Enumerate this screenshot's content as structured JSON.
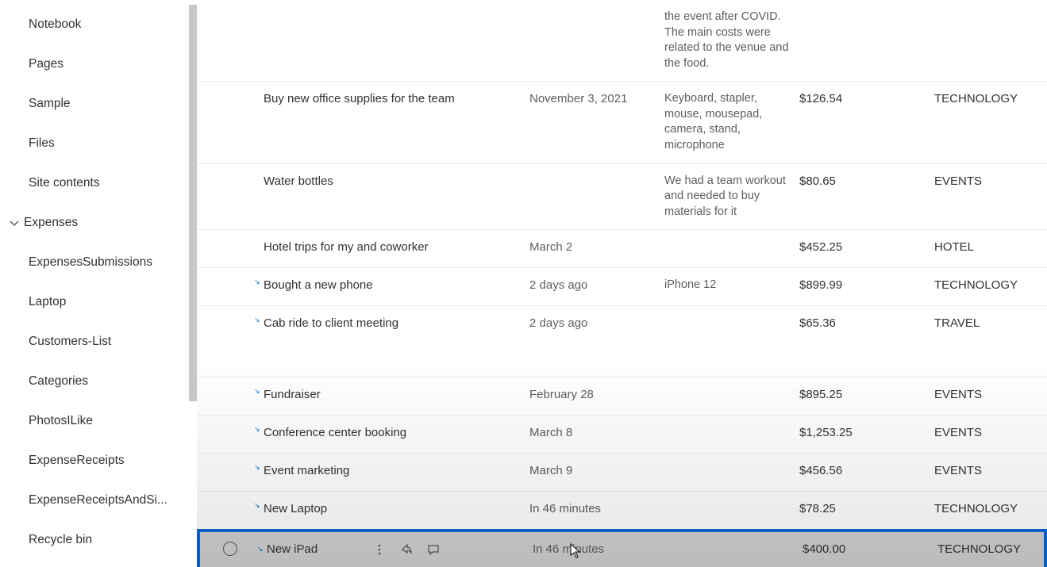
{
  "sidebar": {
    "items": [
      {
        "label": "Notebook"
      },
      {
        "label": "Pages"
      },
      {
        "label": "Sample"
      },
      {
        "label": "Files"
      },
      {
        "label": "Site contents"
      }
    ],
    "section_label": "Expenses",
    "expenses_items": [
      {
        "label": "ExpensesSubmissions"
      },
      {
        "label": "Laptop"
      },
      {
        "label": "Customers-List"
      },
      {
        "label": "Categories"
      },
      {
        "label": "PhotosILike"
      },
      {
        "label": "ExpenseReceipts"
      },
      {
        "label": "ExpenseReceiptsAndSi..."
      },
      {
        "label": "Recycle bin"
      }
    ]
  },
  "rows": [
    {
      "title": "",
      "date": "",
      "desc": "the event after COVID. The main costs were related to the venue and the food.",
      "amount": "",
      "category": "",
      "linked": false
    },
    {
      "title": "Buy new office supplies for the team",
      "date": "November 3, 2021",
      "desc": "Keyboard, stapler, mouse, mousepad, camera, stand, microphone",
      "amount": "$126.54",
      "category": "TECHNOLOGY",
      "linked": false
    },
    {
      "title": "Water bottles",
      "date": "",
      "desc": "We had a team workout and needed to buy materials for it",
      "amount": "$80.65",
      "category": "EVENTS",
      "linked": false
    },
    {
      "title": "Hotel trips for my and coworker",
      "date": "March 2",
      "desc": "",
      "amount": "$452.25",
      "category": "HOTEL",
      "linked": false
    },
    {
      "title": "Bought a new phone",
      "date": "2 days ago",
      "desc": "iPhone 12",
      "amount": "$899.99",
      "category": "TECHNOLOGY",
      "linked": true
    },
    {
      "title": "Cab ride to client meeting",
      "date": "2 days ago",
      "desc": "",
      "amount": "$65.36",
      "category": "TRAVEL",
      "linked": true
    },
    {
      "title": "Fundraiser",
      "date": "February 28",
      "desc": "",
      "amount": "$895.25",
      "category": "EVENTS",
      "linked": true
    },
    {
      "title": "Conference center booking",
      "date": "March 8",
      "desc": "",
      "amount": "$1,253.25",
      "category": "EVENTS",
      "linked": true
    },
    {
      "title": "Event marketing",
      "date": "March 9",
      "desc": "",
      "amount": "$456.56",
      "category": "EVENTS",
      "linked": true
    },
    {
      "title": "New Laptop",
      "date": "In 46 minutes",
      "desc": "",
      "amount": "$78.25",
      "category": "TECHNOLOGY",
      "linked": true
    },
    {
      "title": "New iPad",
      "date": "In 46 minutes",
      "desc": "",
      "amount": "$400.00",
      "category": "TECHNOLOGY",
      "linked": true
    }
  ]
}
